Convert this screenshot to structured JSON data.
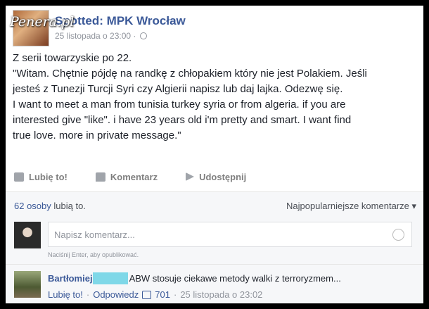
{
  "watermark": "Penera.pl",
  "post": {
    "page_name": "Spotted: MPK Wrocław",
    "timestamp": "25 listopada o 23:00 ·",
    "body_lines": [
      "Z serii towarzyskie po 22.",
      "\"Witam. Chętnie pójdę na randkę z chłopakiem który nie jest Polakiem. Jeśli",
      "jesteś z Tunezji Turcji Syri czy Algierii napisz lub daj lajka. Odezwę się.",
      "I want to meet a man from tunisia turkey syria or from algeria. if you are",
      "interested give \"like\". i have 23 years old i'm pretty and smart. I want find",
      "true love. more in private message.\""
    ]
  },
  "actions": {
    "like": "Lubię to!",
    "comment": "Komentarz",
    "share": "Udostępnij"
  },
  "likes": {
    "count_text": "62 osoby",
    "suffix": "lubią to."
  },
  "sort_label": "Najpopularniejsze komentarze ▾",
  "comment_box": {
    "placeholder": "Napisz komentarz...",
    "hint": "Naciśnij Enter, aby opublikować."
  },
  "comment": {
    "author": "Bartłomiej",
    "text": "ABW stosuje ciekawe metody walki z terroryzmem...",
    "like_label": "Lubię to!",
    "reply_label": "Odpowiedz",
    "like_count": "701",
    "time": "25 listopada o 23:02"
  }
}
